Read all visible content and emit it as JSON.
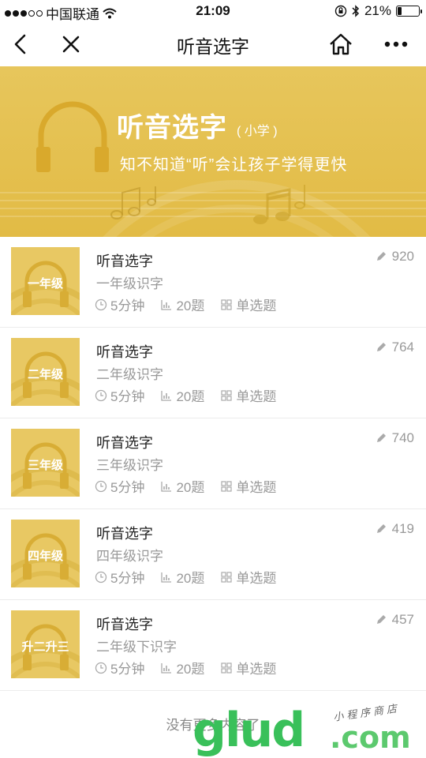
{
  "status": {
    "carrier": "中国联通",
    "time": "21:09",
    "battery": "21%",
    "battery_level": 0.21
  },
  "nav": {
    "title": "听音选字"
  },
  "banner": {
    "title": "听音选字",
    "subtitle": "( 小学 )",
    "desc": "知不知道“听”会让孩子学得更快"
  },
  "items": [
    {
      "grade": "一年级",
      "name": "听音选字",
      "sub": "一年级识字",
      "time": "5分钟",
      "questions": "20题",
      "type": "单选题",
      "count": "920"
    },
    {
      "grade": "二年级",
      "name": "听音选字",
      "sub": "二年级识字",
      "time": "5分钟",
      "questions": "20题",
      "type": "单选题",
      "count": "764"
    },
    {
      "grade": "三年级",
      "name": "听音选字",
      "sub": "三年级识字",
      "time": "5分钟",
      "questions": "20题",
      "type": "单选题",
      "count": "740"
    },
    {
      "grade": "四年级",
      "name": "听音选字",
      "sub": "四年级识字",
      "time": "5分钟",
      "questions": "20题",
      "type": "单选题",
      "count": "419"
    },
    {
      "grade": "升二升三",
      "name": "听音选字",
      "sub": "二年级下识字",
      "time": "5分钟",
      "questions": "20题",
      "type": "单选题",
      "count": "457"
    }
  ],
  "footer": "没有更多内容了",
  "watermark": {
    "logo": "glud",
    "com": ".com",
    "mini": "小程序商店"
  },
  "colors": {
    "accent": "#e2bb45",
    "thumb": "#e8c863",
    "muted": "#999999"
  }
}
